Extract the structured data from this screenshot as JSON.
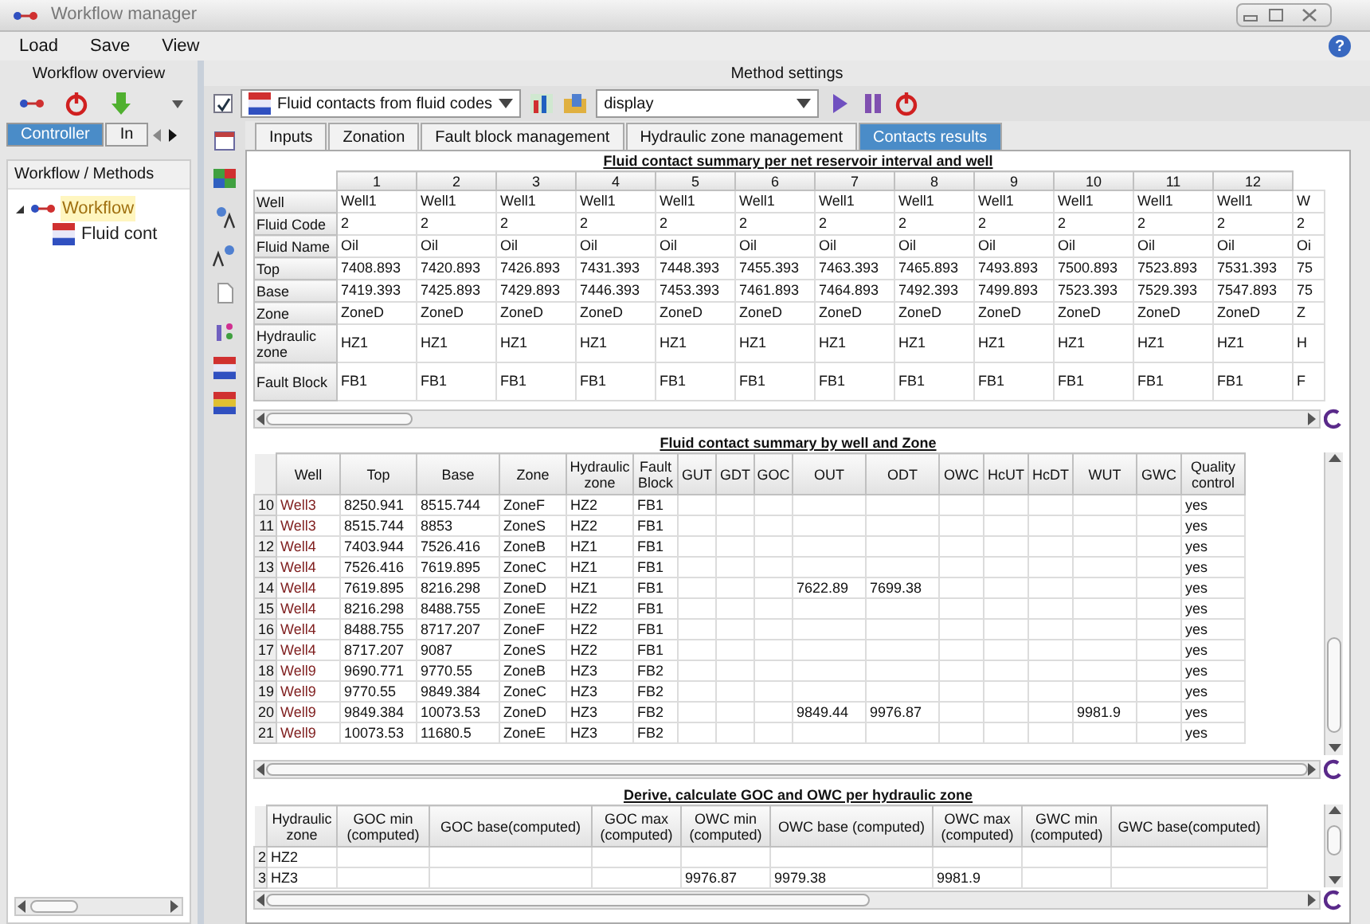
{
  "window": {
    "title": "Workflow manager"
  },
  "menu": [
    "Load",
    "Save",
    "View"
  ],
  "help": "?",
  "left_panel": {
    "title": "Workflow overview",
    "tabs": [
      {
        "label": "Controller",
        "selected": true
      },
      {
        "label": "In",
        "selected": false
      }
    ],
    "tree_title": "Workflow / Methods",
    "tree": [
      {
        "label": "Workflow",
        "kind": "workflow",
        "expanded": true,
        "selected": true,
        "children": [
          {
            "label": "Fluid cont",
            "kind": "method",
            "selected": false
          }
        ]
      }
    ]
  },
  "method_settings": {
    "title": "Method settings",
    "enabled": true,
    "method": "Fluid contacts from fluid codes",
    "mode": "display",
    "tabs": [
      {
        "label": "Inputs",
        "selected": false
      },
      {
        "label": "Zonation",
        "selected": false
      },
      {
        "label": "Fault block management",
        "selected": false
      },
      {
        "label": "Hydraulic zone management",
        "selected": false
      },
      {
        "label": "Contacts results",
        "selected": true
      }
    ]
  },
  "summary_table": {
    "title": "Fluid contact summary per net reservoir interval and well",
    "row_labels": [
      "Well",
      "Fluid Code",
      "Fluid Name",
      "Top",
      "Base",
      "Zone",
      "Hydraulic zone",
      "Fault Block"
    ],
    "columns": [
      {
        "header": "1",
        "values": [
          "Well1",
          "2",
          "Oil",
          "7408.893",
          "7419.393",
          "ZoneD",
          "HZ1",
          "FB1"
        ]
      },
      {
        "header": "2",
        "values": [
          "Well1",
          "2",
          "Oil",
          "7420.893",
          "7425.893",
          "ZoneD",
          "HZ1",
          "FB1"
        ]
      },
      {
        "header": "3",
        "values": [
          "Well1",
          "2",
          "Oil",
          "7426.893",
          "7429.893",
          "ZoneD",
          "HZ1",
          "FB1"
        ]
      },
      {
        "header": "4",
        "values": [
          "Well1",
          "2",
          "Oil",
          "7431.393",
          "7446.393",
          "ZoneD",
          "HZ1",
          "FB1"
        ]
      },
      {
        "header": "5",
        "values": [
          "Well1",
          "2",
          "Oil",
          "7448.393",
          "7453.393",
          "ZoneD",
          "HZ1",
          "FB1"
        ]
      },
      {
        "header": "6",
        "values": [
          "Well1",
          "2",
          "Oil",
          "7455.393",
          "7461.893",
          "ZoneD",
          "HZ1",
          "FB1"
        ]
      },
      {
        "header": "7",
        "values": [
          "Well1",
          "2",
          "Oil",
          "7463.393",
          "7464.893",
          "ZoneD",
          "HZ1",
          "FB1"
        ]
      },
      {
        "header": "8",
        "values": [
          "Well1",
          "2",
          "Oil",
          "7465.893",
          "7492.393",
          "ZoneD",
          "HZ1",
          "FB1"
        ]
      },
      {
        "header": "9",
        "values": [
          "Well1",
          "2",
          "Oil",
          "7493.893",
          "7499.893",
          "ZoneD",
          "HZ1",
          "FB1"
        ]
      },
      {
        "header": "10",
        "values": [
          "Well1",
          "2",
          "Oil",
          "7500.893",
          "7523.393",
          "ZoneD",
          "HZ1",
          "FB1"
        ]
      },
      {
        "header": "11",
        "values": [
          "Well1",
          "2",
          "Oil",
          "7523.893",
          "7529.393",
          "ZoneD",
          "HZ1",
          "FB1"
        ]
      },
      {
        "header": "12",
        "values": [
          "Well1",
          "2",
          "Oil",
          "7531.393",
          "7547.893",
          "ZoneD",
          "HZ1",
          "FB1"
        ]
      },
      {
        "values": [
          "W",
          "2",
          "Oi",
          "75",
          "75",
          "Z",
          "H",
          "F"
        ]
      }
    ]
  },
  "well_zone_table": {
    "title": "Fluid contact summary by well and Zone",
    "columns": [
      "Well",
      "Top",
      "Base",
      "Zone",
      "Hydraulic zone",
      "Fault Block",
      "GUT",
      "GDT",
      "GOC",
      "OUT",
      "ODT",
      "OWC",
      "HcUT",
      "HcDT",
      "WUT",
      "GWC",
      "Quality control"
    ],
    "rows": [
      {
        "number": "10",
        "cells": [
          "Well3",
          "8250.941",
          "8515.744",
          "ZoneF",
          "HZ2",
          "FB1",
          null,
          null,
          null,
          null,
          null,
          null,
          null,
          null,
          null,
          null,
          "yes"
        ]
      },
      {
        "number": "11",
        "cells": [
          "Well3",
          "8515.744",
          "8853",
          "ZoneS",
          "HZ2",
          "FB1",
          null,
          null,
          null,
          null,
          null,
          null,
          null,
          null,
          null,
          null,
          "yes"
        ]
      },
      {
        "number": "12",
        "cells": [
          "Well4",
          "7403.944",
          "7526.416",
          "ZoneB",
          "HZ1",
          "FB1",
          null,
          null,
          null,
          null,
          null,
          null,
          null,
          null,
          null,
          null,
          "yes"
        ]
      },
      {
        "number": "13",
        "cells": [
          "Well4",
          "7526.416",
          "7619.895",
          "ZoneC",
          "HZ1",
          "FB1",
          null,
          null,
          null,
          null,
          null,
          null,
          null,
          null,
          null,
          null,
          "yes"
        ]
      },
      {
        "number": "14",
        "cells": [
          "Well4",
          "7619.895",
          "8216.298",
          "ZoneD",
          "HZ1",
          "FB1",
          null,
          null,
          null,
          "7622.89",
          "7699.38",
          null,
          null,
          null,
          null,
          null,
          "yes"
        ]
      },
      {
        "number": "15",
        "cells": [
          "Well4",
          "8216.298",
          "8488.755",
          "ZoneE",
          "HZ2",
          "FB1",
          null,
          null,
          null,
          null,
          null,
          null,
          null,
          null,
          null,
          null,
          "yes"
        ]
      },
      {
        "number": "16",
        "cells": [
          "Well4",
          "8488.755",
          "8717.207",
          "ZoneF",
          "HZ2",
          "FB1",
          null,
          null,
          null,
          null,
          null,
          null,
          null,
          null,
          null,
          null,
          "yes"
        ]
      },
      {
        "number": "17",
        "cells": [
          "Well4",
          "8717.207",
          "9087",
          "ZoneS",
          "HZ2",
          "FB1",
          null,
          null,
          null,
          null,
          null,
          null,
          null,
          null,
          null,
          null,
          "yes"
        ]
      },
      {
        "number": "18",
        "cells": [
          "Well9",
          "9690.771",
          "9770.55",
          "ZoneB",
          "HZ3",
          "FB2",
          null,
          null,
          null,
          null,
          null,
          null,
          null,
          null,
          null,
          null,
          "yes"
        ]
      },
      {
        "number": "19",
        "cells": [
          "Well9",
          "9770.55",
          "9849.384",
          "ZoneC",
          "HZ3",
          "FB2",
          null,
          null,
          null,
          null,
          null,
          null,
          null,
          null,
          null,
          null,
          "yes"
        ]
      },
      {
        "number": "20",
        "cells": [
          "Well9",
          "9849.384",
          "10073.53",
          "ZoneD",
          "HZ3",
          "FB2",
          null,
          null,
          null,
          "9849.44",
          "9976.87",
          null,
          null,
          null,
          "9981.9",
          null,
          "yes"
        ]
      },
      {
        "number": "21",
        "cells": [
          "Well9",
          "10073.53",
          "11680.5",
          "ZoneE",
          "HZ3",
          "FB2",
          null,
          null,
          null,
          null,
          null,
          null,
          null,
          null,
          null,
          null,
          "yes"
        ]
      }
    ]
  },
  "hydraulic_table": {
    "title": "Derive, calculate GOC and OWC per hydraulic zone",
    "columns": [
      "Hydraulic zone",
      "GOC min (computed)",
      "GOC base(computed)",
      "GOC max (computed)",
      "OWC min (computed)",
      "OWC base (computed)",
      "OWC max (computed)",
      "GWC min (computed)",
      "GWC base(computed)"
    ],
    "rows": [
      {
        "number": "2",
        "cells": [
          "HZ2",
          null,
          null,
          null,
          null,
          null,
          null,
          null,
          null
        ]
      },
      {
        "number": "3",
        "cells": [
          "HZ3",
          null,
          null,
          null,
          "9976.87",
          "9979.38",
          "9981.9",
          null,
          null
        ]
      }
    ]
  }
}
